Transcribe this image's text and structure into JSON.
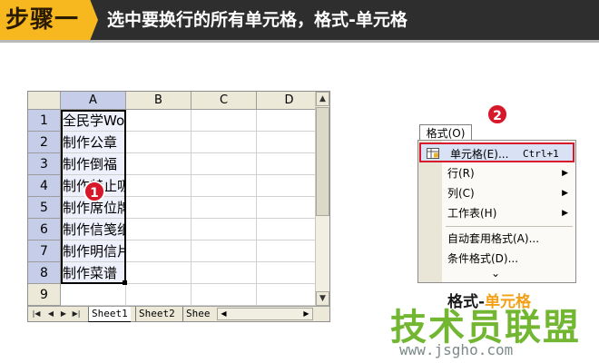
{
  "banner": {
    "step_label": "步骤一",
    "title": "选中要换行的所有单元格，格式-单元格"
  },
  "spreadsheet": {
    "columns": [
      "A",
      "B",
      "C",
      "D"
    ],
    "rows": [
      "1",
      "2",
      "3",
      "4",
      "5",
      "6",
      "7",
      "8",
      "9"
    ],
    "cells_a": [
      "全民学Word",
      "制作公章",
      "制作倒福",
      "制作禁止吸烟",
      "制作席位牌",
      "制作信笺纸",
      "制作明信片",
      "制作菜谱",
      ""
    ],
    "sheet_tabs": [
      "Sheet1",
      "Sheet2",
      "Shee"
    ],
    "badge": "1"
  },
  "menu": {
    "title": "格式(O)",
    "badge": "2",
    "items": [
      {
        "label": "单元格(E)...",
        "shortcut": "Ctrl+1",
        "submenu": false
      },
      {
        "label": "行(R)",
        "shortcut": "",
        "submenu": true
      },
      {
        "label": "列(C)",
        "shortcut": "",
        "submenu": true
      },
      {
        "label": "工作表(H)",
        "shortcut": "",
        "submenu": true
      },
      {
        "label": "自动套用格式(A)...",
        "shortcut": "",
        "submenu": false
      },
      {
        "label": "条件格式(D)...",
        "shortcut": "",
        "submenu": false
      }
    ],
    "expand_glyph": "⌄"
  },
  "caption": {
    "prefix": "格式-",
    "accent": "单元格"
  },
  "logo": {
    "text": "技术员联盟",
    "site": "www.jsgho.com"
  },
  "colors": {
    "banner_bg": "#2e2e2e",
    "step_tag": "#f6b71f",
    "badge_red": "#d6182a",
    "logo_green": "#6bb326",
    "accent_orange": "#f4a017"
  }
}
